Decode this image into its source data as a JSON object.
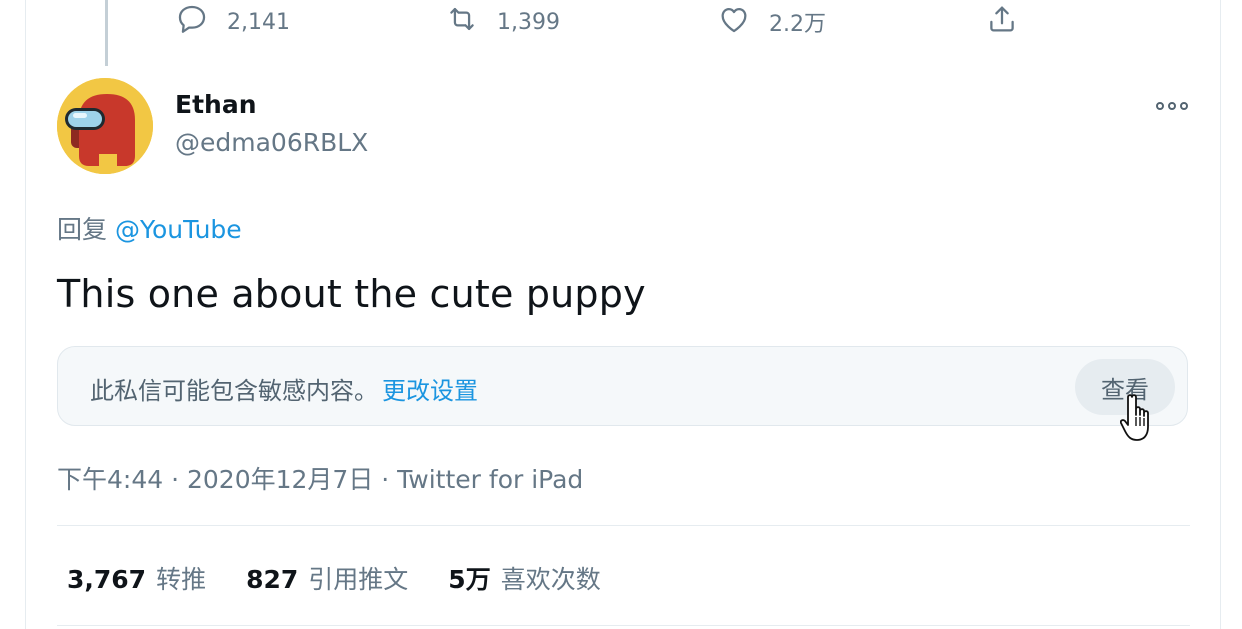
{
  "previous_tweet_actions": {
    "reply_count": "2,141",
    "retweet_count": "1,399",
    "like_count": "2.2万"
  },
  "tweet": {
    "author_name": "Ethan",
    "author_handle": "@edma06RBLX",
    "reply_prefix": "回复",
    "reply_mention": "@YouTube",
    "text": "This one about the cute puppy",
    "sensitive_notice": "此私信可能包含敏感内容。",
    "change_settings_link": "更改设置",
    "view_button": "查看",
    "meta": "下午4:44 · 2020年12月7日 · Twitter for iPad"
  },
  "stats": {
    "retweets_num": "3,767",
    "retweets_label": "转推",
    "quotes_num": "827",
    "quotes_label": "引用推文",
    "likes_num": "5万",
    "likes_label": "喜欢次数"
  },
  "colors": {
    "accent": "#1b95e0",
    "muted": "#657786",
    "avatar_bg": "#f2c744",
    "crewmate_red": "#c8382b",
    "visor": "#9ed3ea"
  },
  "icons": [
    "reply-icon",
    "retweet-icon",
    "like-icon",
    "share-icon",
    "more-icon",
    "cursor-hand-icon"
  ]
}
